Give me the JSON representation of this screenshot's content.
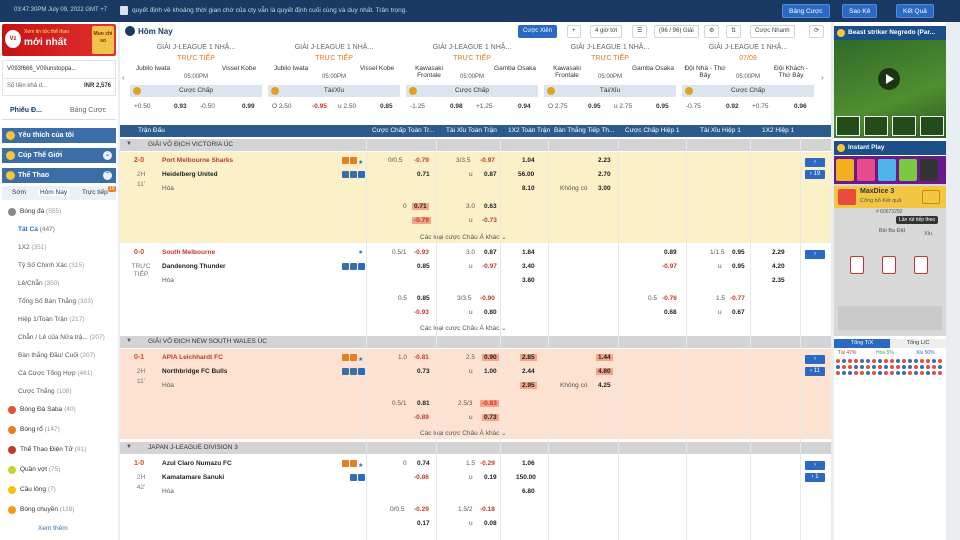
{
  "topbar": {
    "time": "03:47:30PM July 09, 2022 GMT +7",
    "notice": "quyết định về khoảng thời gian chờ của cty vẫn là quyết định cuối cùng và duy nhất. Trân trọng.",
    "buttons": [
      "Bảng Cược",
      "Sao Kê",
      "Kết Quả"
    ]
  },
  "banner": {
    "line1": "Xem tin tức thể thao",
    "line2": "mới nhất",
    "logo": "Vz",
    "pic": "Mun chi so"
  },
  "user": {
    "id": "V093f666_V09unstoppa...",
    "balance_label": "Số tiền khả d...",
    "balance": "INR 2,576"
  },
  "left_tabs": [
    "Phiếu Đ...",
    "Bảng Cược"
  ],
  "sections": {
    "fav": "Yêu thích của tôi",
    "world": "Cúp Thế Giới",
    "sports": "Thể Thao"
  },
  "sub_tabs": [
    "Sớm",
    "Hôm Nay",
    "Trực tiếp"
  ],
  "sub_badge": "19",
  "football": {
    "name": "Bóng đá",
    "count": "(555)"
  },
  "bet_types": [
    {
      "name": "Tất Cả",
      "count": "(447)"
    },
    {
      "name": "1X2",
      "count": "(351)"
    },
    {
      "name": "Tỷ Số Chính Xác",
      "count": "(315)"
    },
    {
      "name": "Lẻ/Chẵn",
      "count": "(350)"
    },
    {
      "name": "Tổng Số Bàn Thắng",
      "count": "(303)"
    },
    {
      "name": "Hiệp 1/Toàn Trận",
      "count": "(217)"
    },
    {
      "name": "Chẵn / Lẻ của Nửa trậ...",
      "count": "(207)"
    },
    {
      "name": "Bàn thắng Đầu/ Cuối",
      "count": "(207)"
    },
    {
      "name": "Cá Cược Tổng Hợp",
      "count": "(461)"
    },
    {
      "name": "Cược Thắng",
      "count": "(108)"
    }
  ],
  "sports": [
    {
      "name": "Bóng Đá Saba",
      "count": "(40)",
      "color": "#e74c3c"
    },
    {
      "name": "Bóng rổ",
      "count": "(147)",
      "color": "#e67e22"
    },
    {
      "name": "Thể Thao Điện Tử",
      "count": "(91)",
      "color": "#c0392b"
    },
    {
      "name": "Quần vợt",
      "count": "(75)",
      "color": "#c4d52a"
    },
    {
      "name": "Cầu lông",
      "count": "(7)",
      "color": "#f1c40f"
    },
    {
      "name": "Bóng chuyền",
      "count": "(118)",
      "color": "#f39c12"
    }
  ],
  "see_more": "Xem thêm",
  "main": {
    "title": "Hôm Nay",
    "controls": {
      "odds_type": "Cược Xiên",
      "add": "+",
      "time": "4 giờ tới",
      "count": "(96 / 96) Giải",
      "sort": "",
      "quick": "Cược Nhanh"
    }
  },
  "cards": [
    {
      "league": "GIẢI J-LEAGUE 1 NHẬ...",
      "home": "Jubilo Iwata",
      "away": "Vissel Kobe",
      "live": "TRỰC TIẾP",
      "time": "05:00PM",
      "market": "Cược Chấp",
      "o1": "+0.50",
      "v1": "0.93",
      "o2": "-0.50",
      "v2": "0.99"
    },
    {
      "league": "GIẢI J-LEAGUE 1 NHẬ...",
      "home": "Jubilo Iwata",
      "away": "Vissel Kobe",
      "live": "TRỰC TIẾP",
      "time": "05:00PM",
      "market": "Tài/Xỉu",
      "o1": "O 2.50",
      "v1": "-0.95",
      "o2": "u 2.50",
      "v2": "0.85"
    },
    {
      "league": "GIẢI J-LEAGUE 1 NHẬ...",
      "home": "Kawasaki Frontale",
      "away": "Gamba Osaka",
      "live": "TRỰC TIẾP",
      "time": "05:00PM",
      "market": "Cược Chấp",
      "o1": "-1.25",
      "v1": "0.98",
      "o2": "+1.25",
      "v2": "0.94"
    },
    {
      "league": "GIẢI J-LEAGUE 1 NHẬ...",
      "home": "Kawasaki Frontale",
      "away": "Gamba Osaka",
      "live": "TRỰC TIẾP",
      "time": "05:00PM",
      "market": "Tài/Xỉu",
      "o1": "O 2.75",
      "v1": "0.95",
      "o2": "u 2.75",
      "v2": "0.95"
    },
    {
      "league": "GIẢI J-LEAGUE 1 NHẬ...",
      "home": "Đội Nhà - Thứ Bảy",
      "away": "Đội Khách - Thứ Bảy",
      "live": "07/09",
      "time": "05:00PM",
      "market": "Cược Chấp",
      "o1": "-0.75",
      "v1": "0.92",
      "o2": "+0.75",
      "v2": "0.96"
    }
  ],
  "table_headers": [
    "Trận Đấu",
    "Cược Chấp Toàn Tr...",
    "Tài Xỉu Toàn Trận",
    "1X2 Toàn Trận",
    "Bàn Thắng Tiếp Th...",
    "Cược Chấp Hiệp 1",
    "Tài Xỉu Hiệp 1",
    "1X2 Hiệp 1"
  ],
  "leagues": [
    "GIẢI VÔ ĐỊCH VICTORIA ÚC",
    "GIẢI VÔ ĐỊCH NEW SOUTH WALES ÚC",
    "JAPAN J-LEAGUE DIVISION 3"
  ],
  "more_text": "Các loại cược Châu Á khác",
  "matches": [
    {
      "score": "2-0",
      "status1": "2H",
      "status2": "11'",
      "home": "Port Melbourne Sharks",
      "away": "Heidelberg United",
      "draw": "Hòa",
      "more_btn": "› 19"
    },
    {
      "score": "0-0",
      "status1": "TRỰC TIẾP",
      "status2": "",
      "home": "South Melbourne",
      "away": "Dandenong Thunder",
      "draw": "Hòa",
      "more_btn": "›"
    },
    {
      "score": "0-1",
      "status1": "2H",
      "status2": "11'",
      "home": "APIA Leichhardt FC",
      "away": "Northbridge FC Bulls",
      "draw": "Hòa",
      "more_btn": "› 11"
    },
    {
      "score": "1-0",
      "status1": "2H",
      "status2": "42'",
      "home": "Azul Claro Numazu FC",
      "away": "Kamatamare Sanuki",
      "draw": "Hòa",
      "more_btn": "› 1"
    }
  ],
  "m1": {
    "hcap1": "0/0.5",
    "hv1": "-0.79",
    "hv2": "0.71",
    "ou1": "3/3.5",
    "ouv1": "-0.97",
    "ouu": "u",
    "ouv2": "0.87",
    "x1": "1.04",
    "x2": "56.00",
    "x3": "8.10",
    "ng1": "2.23",
    "ng2": "2.70",
    "ngno": "Không có",
    "ng3": "3.00",
    "r2h": "0",
    "r2v1": "0.71",
    "r2v2": "-0.79",
    "r2ou": "3.0",
    "r2ouv1": "0.63",
    "r2ouu": "u",
    "r2ouv2": "-0.73"
  },
  "m2": {
    "hcap1": "0.5/1",
    "hv1": "-0.93",
    "hv2": "0.85",
    "ou1": "3.0",
    "ouv1": "0.87",
    "ouu": "u",
    "ouv2": "-0.97",
    "x1": "1.84",
    "x2": "3.40",
    "x3": "3.80",
    "h1v1": "0.89",
    "h1v2": "-0.97",
    "h1ou": "1/1.5",
    "h1ouv1": "0.95",
    "h1ouu": "u",
    "h1ouv2": "0.95",
    "h1x1": "2.29",
    "h1x2": "4.20",
    "h1x3": "2.35",
    "r2h": "0.5",
    "r2v1": "0.85",
    "r2v2": "-0.93",
    "r2ou": "3/3.5",
    "r2ouv1": "-0.90",
    "r2ouu": "u",
    "r2ouv2": "0.80",
    "r2h1": "0.5",
    "r2h1v1": "-0.76",
    "r2h1v2": "0.68",
    "r2h1ou": "1.5",
    "r2h1ouv1": "-0.77",
    "r2h1ouu": "u",
    "r2h1ouv2": "0.67"
  },
  "m3": {
    "hcap1": "1.0",
    "hv1": "-0.81",
    "hv2": "0.73",
    "ou1": "2.5",
    "ouv1": "0.90",
    "ouu": "u",
    "ouv2": "1.00",
    "x1": "2.85",
    "x2": "2.44",
    "x3": "2.95",
    "ng1": "1.44",
    "ng2": "4.80",
    "ngno": "Không có",
    "ng3": "4.25",
    "r2h": "0.5/1",
    "r2v1": "0.81",
    "r2v2": "-0.89",
    "r2ou": "2.5/3",
    "r2ouv1": "-0.83",
    "r2ouu": "u",
    "r2ouv2": "0.73"
  },
  "m4": {
    "hcap1": "0",
    "hv1": "0.74",
    "hv2": "-0.86",
    "ou1": "1.5",
    "ouv1": "-0.29",
    "ouu": "u",
    "ouv2": "0.19",
    "x1": "1.06",
    "x2": "150.00",
    "x3": "6.80",
    "r2h": "0/0.5",
    "r2v1": "-0.29",
    "r2v2": "0.17",
    "r2ou": "1.5/2",
    "r2ouv1": "-0.18",
    "r2ouu": "u",
    "r2ouv2": "0.08"
  },
  "right": {
    "video_title": "Beast striker Negredo (Par...",
    "instant_play": "Instant Play",
    "game_name": "MaxDice 3",
    "game_sub": "Cổng bỏ Kết quả",
    "round": "# 60673292",
    "tooltip": "Lần rút tiếp theo",
    "labels": [
      "Bài Ba Đặt",
      "Xỉu"
    ],
    "bottom_tabs": [
      "Tổng T/X",
      "Tổng L/C"
    ],
    "stats": [
      "Tài 47%",
      "Hòa 5%",
      "Xỉu 50%"
    ]
  }
}
